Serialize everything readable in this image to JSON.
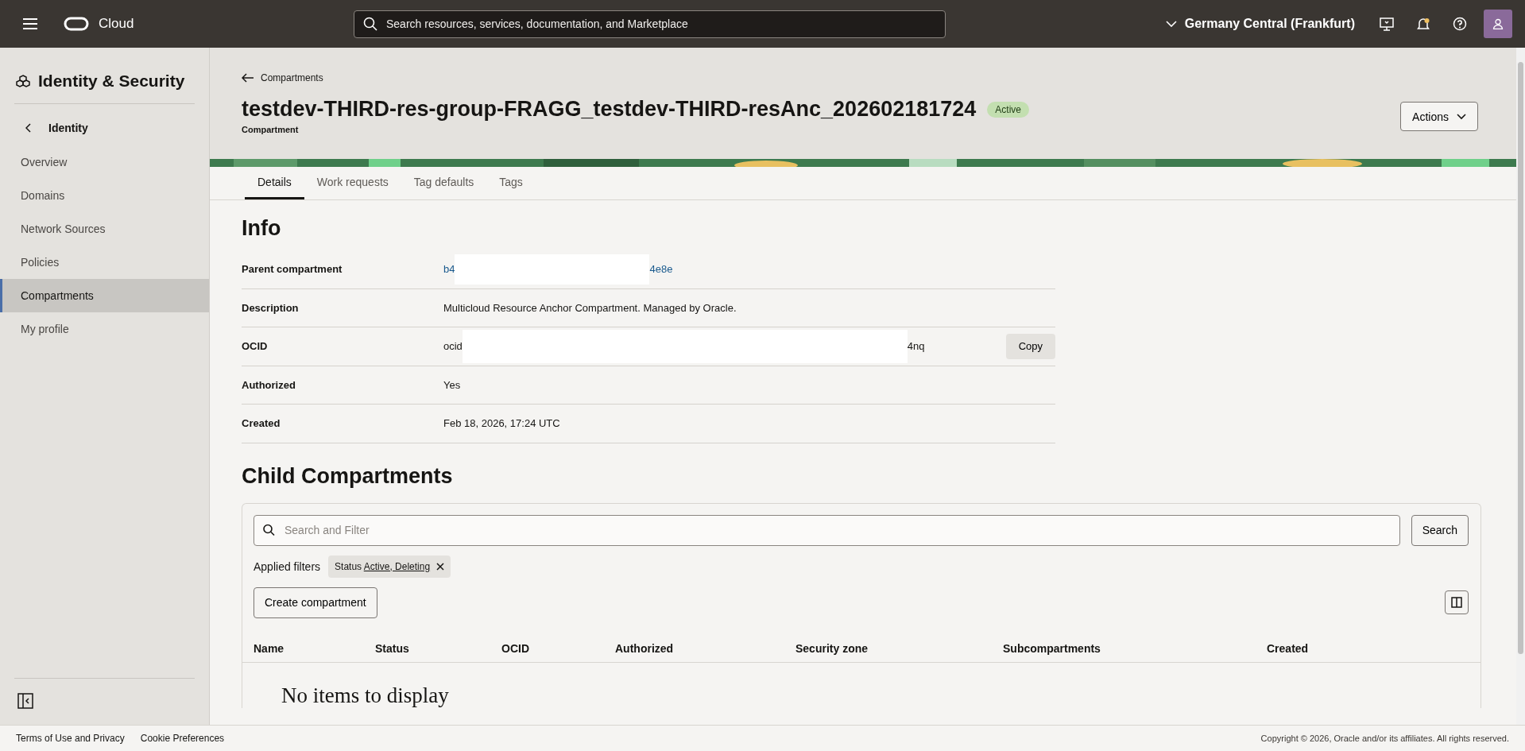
{
  "top_bar": {
    "brand": "Cloud",
    "search": {
      "placeholder": "Search resources, services, documentation, and Marketplace"
    },
    "region": "Germany Central (Frankfurt)"
  },
  "sidebar": {
    "title": "Identity & Security",
    "back": "Identity",
    "items": [
      {
        "label": "Overview",
        "selected": false
      },
      {
        "label": "Domains",
        "selected": false
      },
      {
        "label": "Network Sources",
        "selected": false
      },
      {
        "label": "Policies",
        "selected": false
      },
      {
        "label": "Compartments",
        "selected": true
      },
      {
        "label": "My profile",
        "selected": false
      }
    ]
  },
  "header": {
    "back_link": "Compartments",
    "title": "testdev-THIRD-res-group-FRAGG_testdev-THIRD-resAnc_202602181724",
    "status": "Active",
    "subtitle": "Compartment",
    "actions": "Actions"
  },
  "tabs": [
    {
      "label": "Details",
      "selected": true
    },
    {
      "label": "Work requests",
      "selected": false
    },
    {
      "label": "Tag defaults",
      "selected": false
    },
    {
      "label": "Tags",
      "selected": false
    }
  ],
  "info": {
    "heading": "Info",
    "rows": [
      {
        "kind": "link",
        "label": "Parent compartment",
        "value_start": "b4",
        "value_end": "4e8e",
        "redacted": true
      },
      {
        "kind": "text",
        "label": "Description",
        "value": "Multicloud Resource Anchor Compartment. Managed by Oracle."
      },
      {
        "kind": "copy",
        "label": "OCID",
        "value_start": "ocid",
        "value_end": "4nq",
        "redacted": true,
        "button": "Copy"
      },
      {
        "kind": "text",
        "label": "Authorized",
        "value": "Yes"
      },
      {
        "kind": "text",
        "label": "Created",
        "value": "Feb 18, 2026, 17:24 UTC"
      }
    ]
  },
  "child_compartments": {
    "heading": "Child Compartments",
    "search": {
      "placeholder": "Search and Filter"
    },
    "search_button": "Search",
    "filters_label": "Applied filters",
    "filter": {
      "name": "Status",
      "value": "Active, Deleting"
    },
    "create_button": "Create compartment",
    "columns": [
      "Name",
      "Status",
      "OCID",
      "Authorized",
      "Security zone",
      "Subcompartments",
      "Created"
    ],
    "empty": "No items to display"
  },
  "footer": {
    "links": [
      "Terms of Use and Privacy",
      "Cookie Preferences"
    ],
    "copyright": "Copyright © 2026, Oracle and/or its affiliates. All rights reserved."
  }
}
